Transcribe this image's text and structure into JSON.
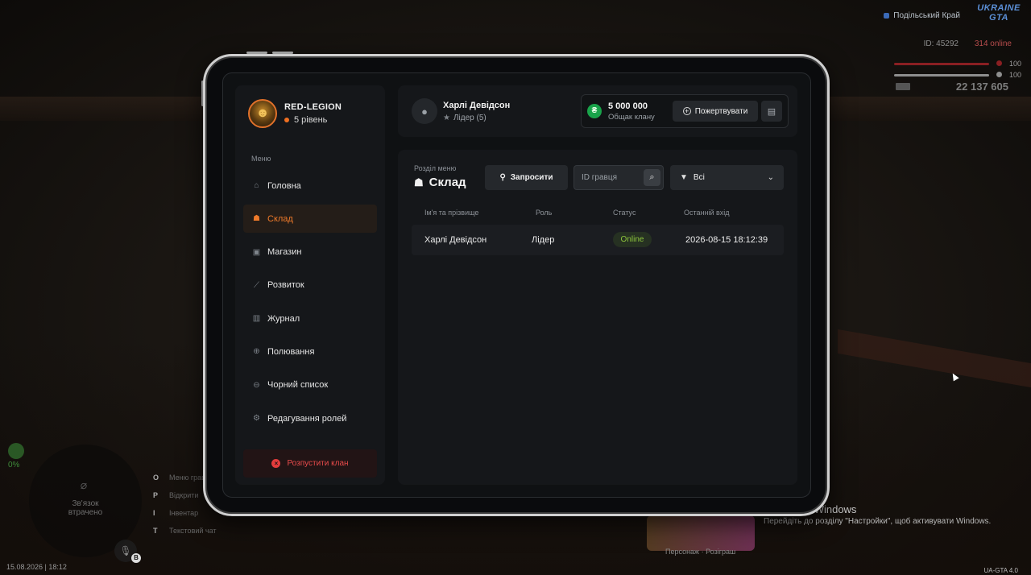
{
  "hud": {
    "region": "Подільський Край",
    "logo_line1": "UKRAINE",
    "logo_line2": "GTA",
    "player_id": "ID: 45292",
    "online": "314 online",
    "health": "100",
    "armor": "100",
    "money": "22 137 605",
    "radar_text": "Зв'язок втрачено",
    "hp_small": "0%",
    "mic_key": "B",
    "hotkeys": [
      {
        "key": "O",
        "label": "Меню гравця"
      },
      {
        "key": "P",
        "label": "Відкрити"
      },
      {
        "key": "I",
        "label": "Інвентар"
      },
      {
        "key": "T",
        "label": "Текстовий чат"
      }
    ],
    "datetime": "15.08.2026 | 18:12",
    "promo_caption": "Персонаж · Розіграш",
    "activation_title": "Активація Windows",
    "activation_text": "Перейдіть до розділу \"Настройки\", щоб активувати Windows.",
    "build": "UA-GTA 4.0"
  },
  "clan": {
    "name": "RED-LEGION",
    "level": "5 рівень"
  },
  "menu": {
    "caption": "Меню",
    "items": [
      {
        "label": "Головна",
        "icon": "home-icon",
        "active": false
      },
      {
        "label": "Склад",
        "icon": "people-icon",
        "active": true
      },
      {
        "label": "Магазин",
        "icon": "basket-icon",
        "active": false
      },
      {
        "label": "Розвиток",
        "icon": "chart-icon",
        "active": false
      },
      {
        "label": "Журнал",
        "icon": "book-icon",
        "active": false
      },
      {
        "label": "Полювання",
        "icon": "crosshair-icon",
        "active": false
      },
      {
        "label": "Чорний список",
        "icon": "minus-circle-icon",
        "active": false
      },
      {
        "label": "Редагування ролей",
        "icon": "user-cog-icon",
        "active": false
      }
    ],
    "disband": "Розпустити клан"
  },
  "user": {
    "name": "Харлі Девідсон",
    "role": "Лідер (5)"
  },
  "balance": {
    "amount": "5 000 000",
    "label": "Общак клану",
    "donate": "Пожертвувати"
  },
  "section": {
    "caption": "Розділ меню",
    "title": "Склад",
    "invite": "Запросити",
    "search_placeholder": "ID гравця",
    "filter": "Всі"
  },
  "table": {
    "headers": [
      "Ім'я та прізвище",
      "Роль",
      "Статус",
      "Останній вхід"
    ],
    "rows": [
      {
        "name": "Харлі Девідсон",
        "role": "Лідер",
        "status": "Online",
        "last_login": "2026-08-15 18:12:39"
      }
    ]
  },
  "colors": {
    "accent": "#ef7a2a",
    "online": "#8cc43c",
    "danger": "#e43c3c",
    "coin": "#19a34a"
  }
}
